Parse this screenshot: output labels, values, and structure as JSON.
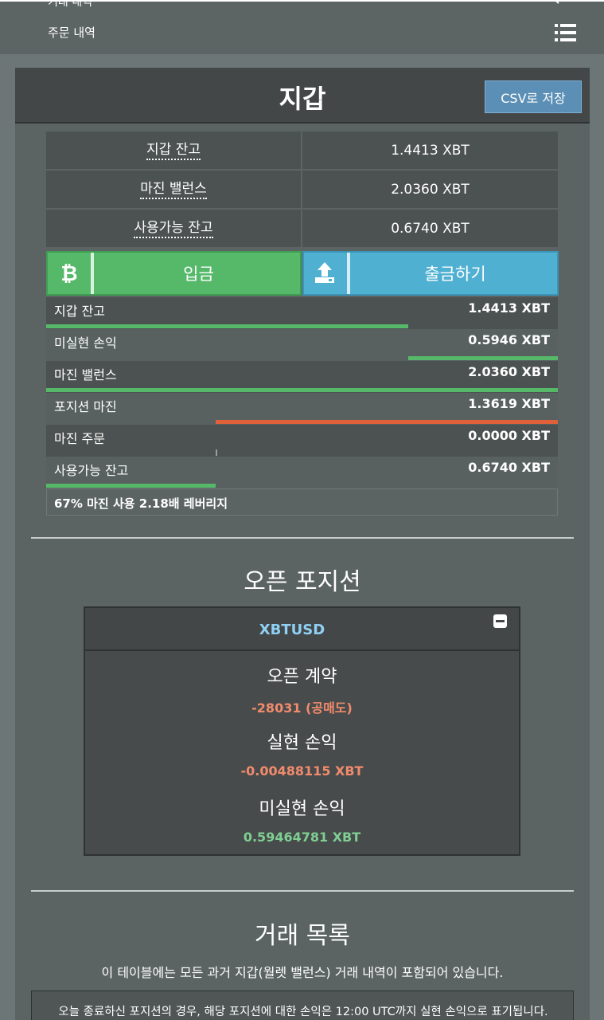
{
  "topnav": {
    "cut_text": "거래 내역",
    "order_history": "주문 내역"
  },
  "wallet": {
    "title": "지갑",
    "csv_button": "CSV로 저장",
    "summary": [
      {
        "label": "지갑 잔고",
        "value": "1.4413 XBT"
      },
      {
        "label": "마진 밸런스",
        "value": "2.0360 XBT"
      },
      {
        "label": "사용가능 잔고",
        "value": "0.6740 XBT"
      }
    ],
    "deposit_label": "입금",
    "withdraw_label": "출금하기",
    "breakdown": [
      {
        "label": "지갑 잔고",
        "value": "1.4413 XBT",
        "bar_color": "#56b96a",
        "bar_start": 0.0,
        "bar_fraction": 0.708
      },
      {
        "label": "미실현 손익",
        "value": "0.5946 XBT",
        "bar_color": "#56b96a",
        "bar_start": 0.708,
        "bar_fraction": 0.292
      },
      {
        "label": "마진 밸런스",
        "value": "2.0360 XBT",
        "bar_color": "#56b96a",
        "bar_start": 0.0,
        "bar_fraction": 1.0
      },
      {
        "label": "포지션 마진",
        "value": "1.3619 XBT",
        "bar_color": "#e0603a",
        "bar_start": 0.331,
        "bar_fraction": 0.669
      },
      {
        "label": "마진 주문",
        "value": "0.0000 XBT",
        "bar_color": "#9aa0a0",
        "bar_start": 0.331,
        "bar_fraction": 0.003
      },
      {
        "label": "사용가능 잔고",
        "value": "0.6740 XBT",
        "bar_color": "#56b96a",
        "bar_start": 0.0,
        "bar_fraction": 0.331
      }
    ],
    "footer": "67% 마진 사용 2.18배 레버리지"
  },
  "open_positions": {
    "title": "오픈 포지션",
    "symbol": "XBTUSD",
    "open_contracts_label": "오픈 계약",
    "open_contracts_value": "-28031 (공매도)",
    "realized_pnl_label": "실현 손익",
    "realized_pnl_value": "-0.00488115 XBT",
    "unrealized_pnl_label": "미실현 손익",
    "unrealized_pnl_value": "0.59464781 XBT",
    "negative_color": "#f28b6d",
    "positive_color": "#7fcf93"
  },
  "trade_history": {
    "title": "거래 목록",
    "description": "이 테이블에는 모든 과거 지갑(월렛 밸런스) 거래 내역이 포함되어 있습니다.",
    "notice": "오늘 종료하신 포지션의 경우, 해당 포지션에 대한 손익은 12:00 UTC까지 실현 손익으로 표기됩니다."
  }
}
